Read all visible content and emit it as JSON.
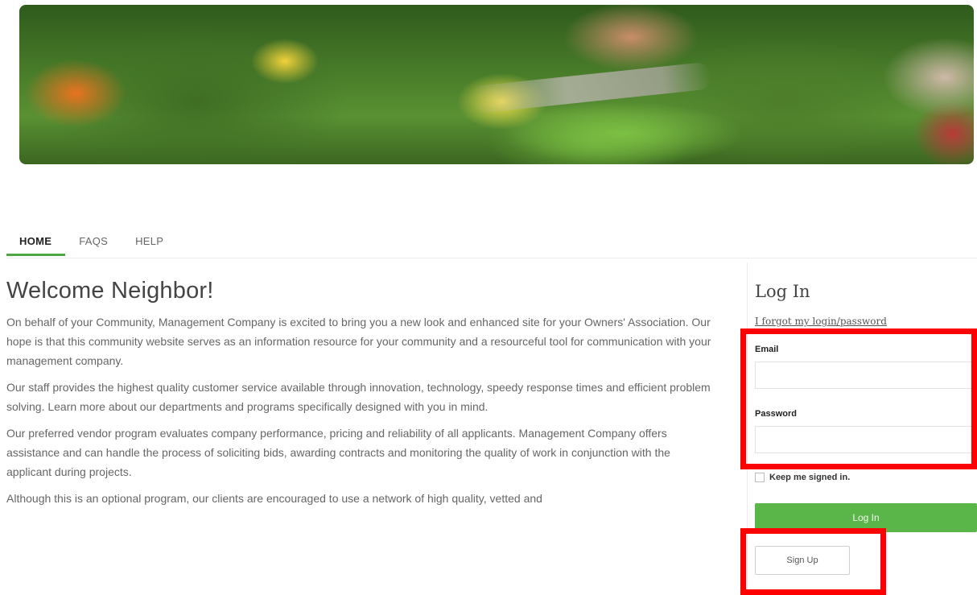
{
  "nav": {
    "tabs": [
      {
        "label": "HOME",
        "active": true
      },
      {
        "label": "FAQS",
        "active": false
      },
      {
        "label": "HELP",
        "active": false
      }
    ]
  },
  "main": {
    "title": "Welcome Neighbor!",
    "paragraphs": [
      "On behalf of your Community, Management Company is excited to bring you a new look and enhanced site for your Owners' Association. Our hope is that this community website serves as an information resource for your community and a resourceful tool for communication with your management company.",
      "Our staff provides the highest quality customer service available through innovation, technology, speedy response times and efficient problem solving. Learn more about our departments and programs specifically designed with you in mind.",
      "Our preferred vendor program evaluates company performance, pricing and reliability of all applicants. Management Company offers assistance and can handle the process of soliciting bids, awarding contracts and monitoring the quality of work in conjunction with the applicant during projects.",
      "Although this is an optional program, our clients are encouraged to use a network of high quality, vetted and"
    ]
  },
  "login": {
    "title": "Log In",
    "forgot_link": "I forgot my login/password",
    "email_label": "Email",
    "email_value": "",
    "password_label": "Password",
    "password_value": "",
    "keep_signed_in_label": "Keep me signed in.",
    "keep_signed_in_checked": false,
    "login_button": "Log In",
    "signup_button": "Sign Up"
  },
  "colors": {
    "accent_green": "#5bb64a",
    "highlight_red": "#ff0000"
  }
}
